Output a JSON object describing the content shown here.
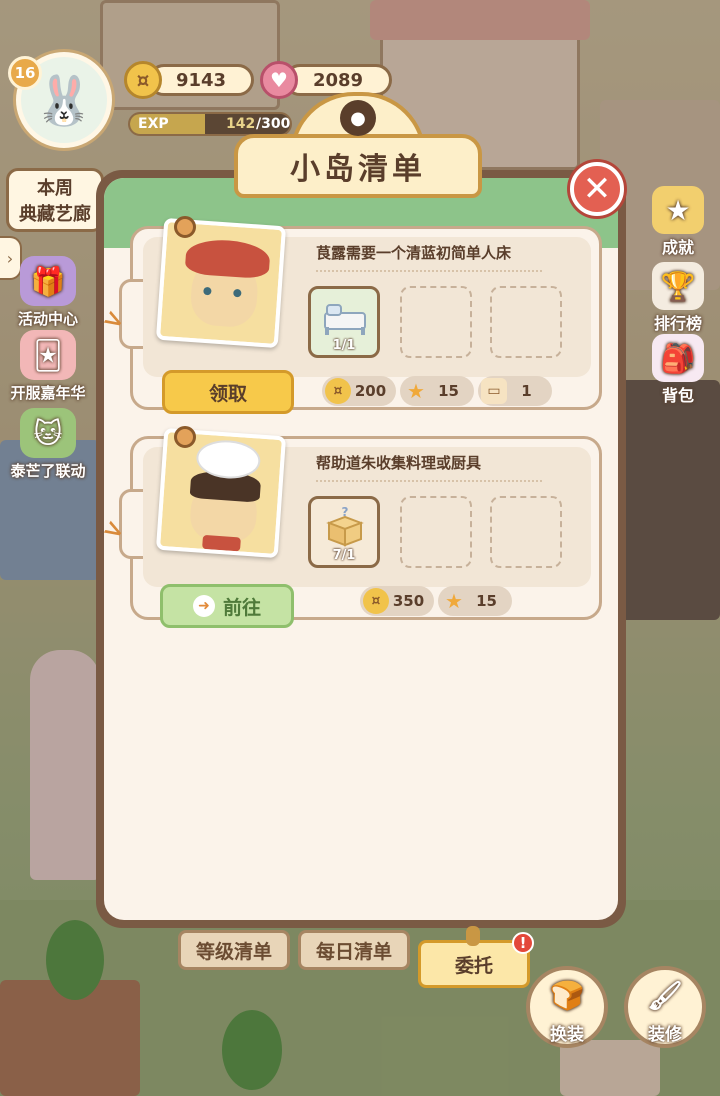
{
  "hud": {
    "level": "16",
    "coins": "9143",
    "hearts": "2089",
    "exp_label": "EXP",
    "exp_current": "142",
    "exp_total": "/300",
    "exp_progress": 0.47
  },
  "left_menu": {
    "weekly_line1": "本周",
    "weekly_line2": "典藏艺廊",
    "items": [
      {
        "label": "活动中心",
        "icon": "gift-icon"
      },
      {
        "label": "开服嘉年华",
        "icon": "jester-icon"
      },
      {
        "label": "泰芒了联动",
        "icon": "cat-icon"
      }
    ]
  },
  "right_menu": {
    "items": [
      {
        "label": "成就",
        "icon": "star-badge-icon"
      },
      {
        "label": "排行榜",
        "icon": "podium-icon"
      },
      {
        "label": "背包",
        "icon": "bunny-bag-icon"
      }
    ]
  },
  "modal": {
    "title": "小岛清单",
    "close_glyph": "✕",
    "tasks": [
      {
        "text": "茛露需要一个清蓝初简单人床",
        "slot_count": "1/1",
        "slot_item": "bed-icon",
        "rewards": [
          {
            "icon": "coin-icon",
            "value": "200"
          },
          {
            "icon": "star-icon",
            "value": "15"
          },
          {
            "icon": "box-icon",
            "value": "1"
          }
        ],
        "action": "领取",
        "action_type": "claim"
      },
      {
        "text": "帮助道朱收集料理或厨具",
        "slot_count": "7/1",
        "slot_item": "mystery-box-icon",
        "rewards": [
          {
            "icon": "coin-icon",
            "value": "350"
          },
          {
            "icon": "star-icon",
            "value": "15"
          }
        ],
        "action": "前往",
        "action_type": "go"
      }
    ]
  },
  "bottom_tabs": {
    "level_list": "等级清单",
    "daily_list": "每日清单",
    "commission": "委托",
    "alert": "!"
  },
  "bottom_buttons": {
    "outfit": "换装",
    "decorate": "装修"
  },
  "colors": {
    "modal_frame": "#7a5a44",
    "modal_header_green": "#8dc48a",
    "claim_yellow": "#f7c94a",
    "go_green": "#c5e3a4",
    "close_red": "#e36052"
  }
}
